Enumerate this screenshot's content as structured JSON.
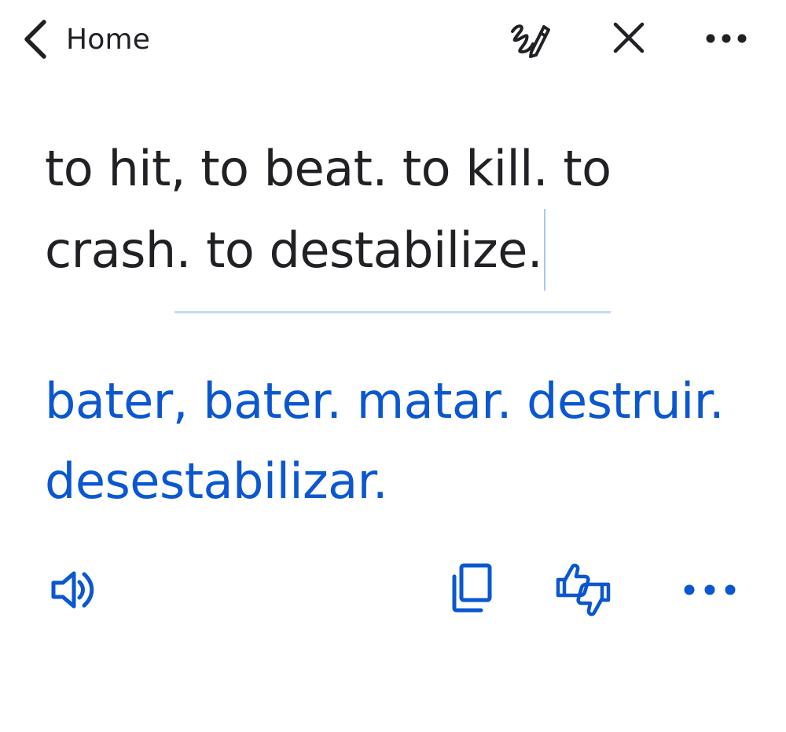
{
  "header": {
    "back_label": "Home",
    "icons": [
      "chevron-left-icon",
      "handwriting-icon",
      "close-icon",
      "more-vert-icon"
    ]
  },
  "source": {
    "text": "to hit, to beat. to kill. to crash. to destabilize."
  },
  "translation": {
    "text": "bater, bater. matar. destruir. desestabilizar.",
    "icons": [
      "speaker-icon",
      "copy-icon",
      "feedback-icon",
      "more-horiz-icon"
    ]
  },
  "colors": {
    "accent": "#0b57d0",
    "text": "#202124",
    "divider": "#c2dcf7",
    "caret": "#a8c7fa"
  }
}
